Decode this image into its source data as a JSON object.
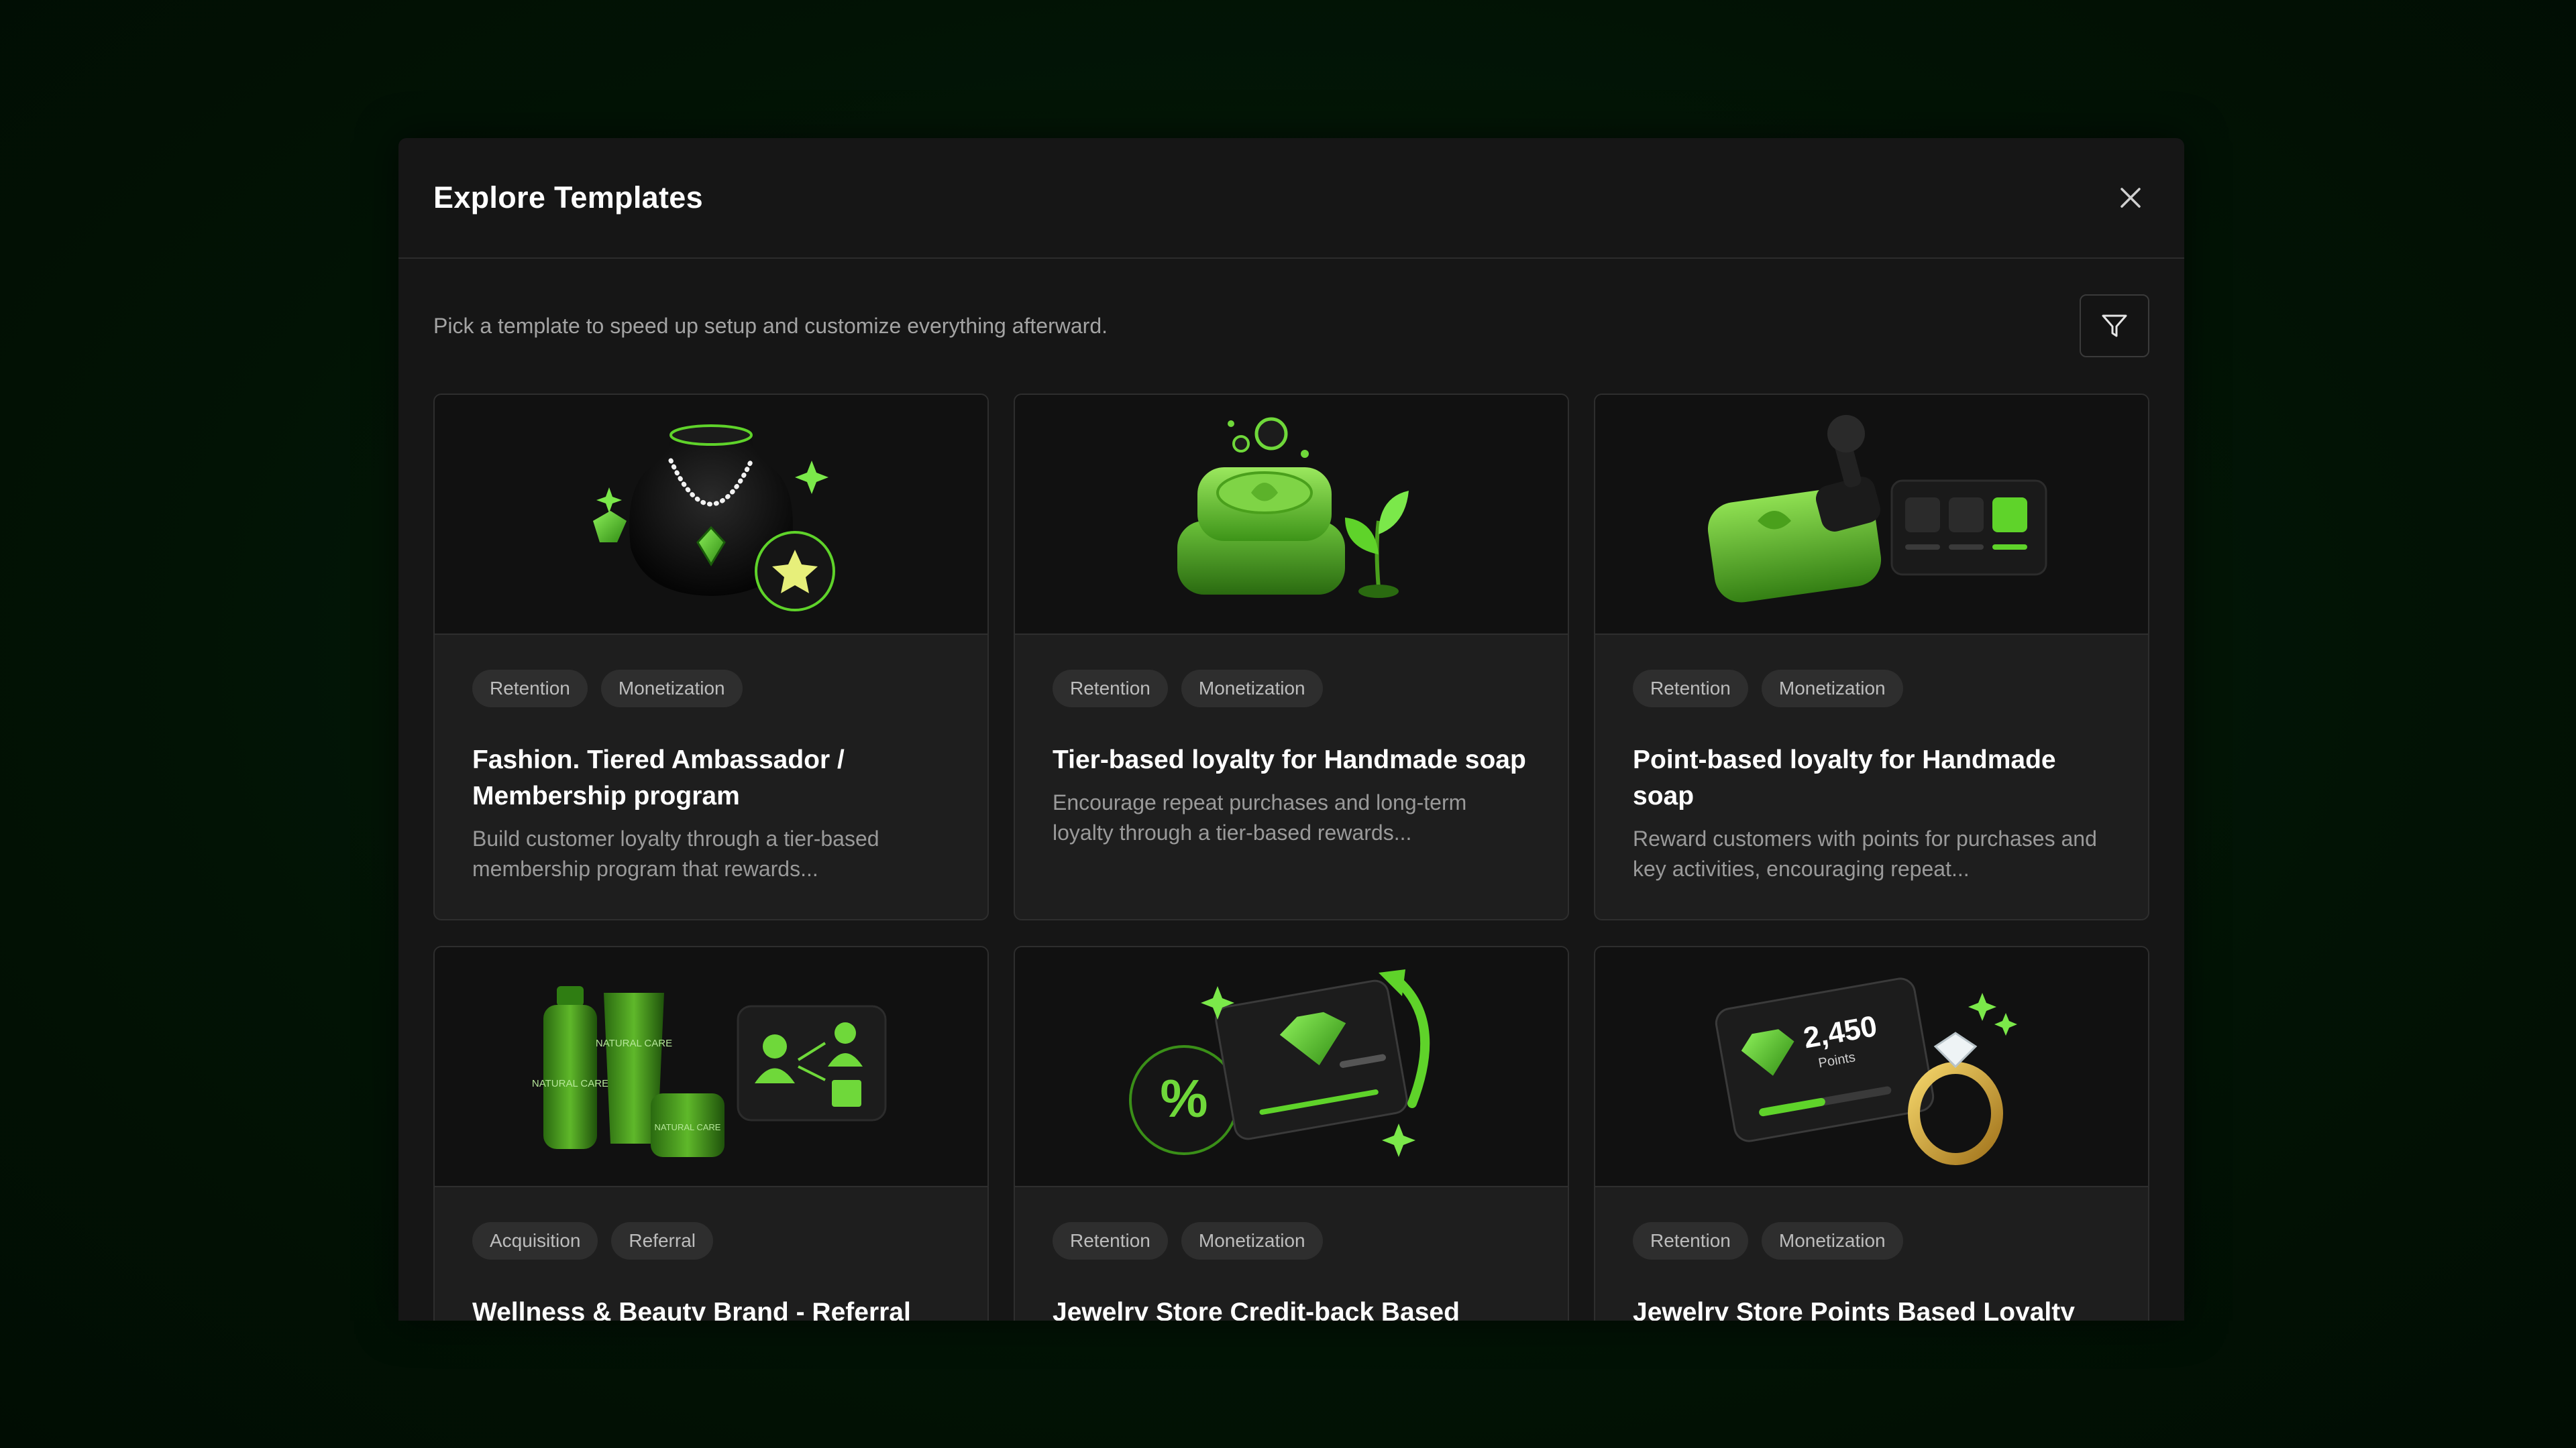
{
  "modal": {
    "title": "Explore Templates",
    "subtitle": "Pick a template to speed up setup and customize everything afterward."
  },
  "colors": {
    "accent": "#5fd32a",
    "accent_dark": "#2e7d14",
    "background": "#021305",
    "modal": "#161616",
    "card": "#1e1e1e"
  },
  "icons": {
    "close": "close-icon",
    "filter": "filter-icon"
  },
  "cards": [
    {
      "tags": [
        "Retention",
        "Monetization"
      ],
      "title": "Fashion. Tiered Ambassador / Membership program",
      "description": "Build customer loyalty through a tier-based membership program that rewards...",
      "illustration": "necklace-star-illustration"
    },
    {
      "tags": [
        "Retention",
        "Monetization"
      ],
      "title": "Tier-based loyalty for Handmade soap",
      "description": "Encourage repeat purchases and long-term loyalty through a tier-based rewards...",
      "illustration": "soap-stack-illustration"
    },
    {
      "tags": [
        "Retention",
        "Monetization"
      ],
      "title": "Point-based loyalty for Handmade soap",
      "description": "Reward customers with points for purchases and key activities, encouraging repeat...",
      "illustration": "soap-stamp-card-illustration"
    },
    {
      "tags": [
        "Acquisition",
        "Referral"
      ],
      "title": "Wellness & Beauty Brand - Referral",
      "description": "",
      "illustration": "cosmetics-referral-illustration",
      "bottle_labels": [
        "NATURAL CARE",
        "NATURAL CARE",
        "NATURAL CARE"
      ]
    },
    {
      "tags": [
        "Retention",
        "Monetization"
      ],
      "title": "Jewelry Store Credit-back Based",
      "description": "",
      "illustration": "credit-card-percent-illustration"
    },
    {
      "tags": [
        "Retention",
        "Monetization"
      ],
      "title": "Jewelry Store Points Based Loyalty",
      "description": "",
      "illustration": "points-card-ring-illustration",
      "points_value": "2,450",
      "points_label": "Points"
    }
  ]
}
